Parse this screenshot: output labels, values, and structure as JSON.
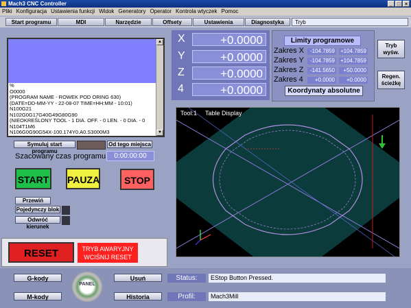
{
  "window": {
    "title": "Mach3 CNC Controller"
  },
  "window_buttons": [
    "_",
    "□",
    "×"
  ],
  "menu": [
    "Pliki",
    "Konfiguracja",
    "Ustawienia funkcji",
    "Widok",
    "Generatory",
    "Operator",
    "Kontrola wtyczek",
    "Pomoc"
  ],
  "tabs": [
    "Start programu",
    "MDI",
    "Narzędzie",
    "Offsety",
    "Ustawienia",
    "Diagnostyka"
  ],
  "mode_field": "Tryb",
  "gcode": {
    "lines": [
      "%",
      "O0000",
      "(PROGRAM NAME - ROWEK POD ORING 630)",
      "(DATE=DD-MM-YY - 22-08-07 TIME=HH:MM - 10:01)",
      "N100G21",
      "N102G0G17G40G49G80G90",
      "(NIEOKREŚLONY TOOL - 1 DIA. OFF. - 0 LEN. - 0 DIA. - 0",
      "N104T1M6",
      "N106G0G90G54X-100.174Y0.A0.S3000M3"
    ]
  },
  "sim": {
    "simulate_label": "Symuluj start programu",
    "from_here_label": "Od tego miejsca",
    "est_time_label": "Szacowany czas programu:",
    "est_time_value": "0:00:00:00"
  },
  "run_buttons": {
    "start": "START",
    "pause": "PAUZA",
    "stop": "STOP"
  },
  "small_buttons": {
    "rewind": "Przewiń",
    "single_block": "Pojedynczy blok",
    "reverse": "Odwróć kierunek"
  },
  "reset": {
    "label": "RESET",
    "estop_line1": "TRYB AWARYJNY",
    "estop_line2": "WCIŚNIJ RESET"
  },
  "dro": [
    {
      "axis": "X",
      "value": "+0.0000"
    },
    {
      "axis": "Y",
      "value": "+0.0000"
    },
    {
      "axis": "Z",
      "value": "+0.0000"
    },
    {
      "axis": "4",
      "value": "+0.0000"
    }
  ],
  "limits": {
    "title": "Limity programowe",
    "rows": [
      {
        "label": "Zakres X",
        "min": "-104.7859",
        "max": "+104.7859"
      },
      {
        "label": "Zakres Y",
        "min": "-104.7859",
        "max": "+104.7859"
      },
      {
        "label": "Zakres Z",
        "min": "-141.5650",
        "max": "+50.0000"
      },
      {
        "label": "Zakres 4",
        "min": "+0.0000",
        "max": "+0.0000"
      }
    ],
    "coords_button": "Koordynaty absolutne"
  },
  "side_buttons": {
    "mode_line1": "Tryb",
    "mode_line2": "wyśw.",
    "regen_line1": "Regen.",
    "regen_line2": "ścieżkę"
  },
  "toolpath": {
    "tool": "Tool:1",
    "display": "Table Display"
  },
  "footer": {
    "gcode_btn": "G-kody",
    "mcode_btn": "M-kody",
    "delete_btn": "Usuń",
    "history_btn": "Historia",
    "status_label": "Status:",
    "status_value": "EStop Button Pressed.",
    "profile_label": "Profil:",
    "profile_value": "Mach3Mill",
    "logo_text": "PANEL"
  },
  "colors": {
    "panel": "#9aa3c4",
    "dro_bg": "#8a90d8",
    "start": "#1ec04a",
    "pause": "#f0f040",
    "stop": "#ff6060",
    "reset": "#e02020"
  }
}
